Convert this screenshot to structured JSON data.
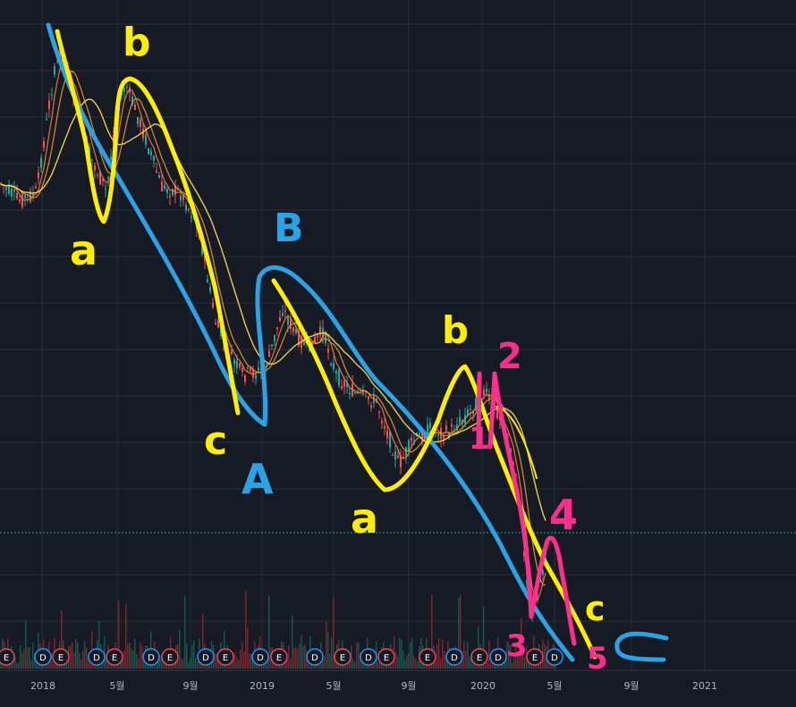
{
  "chart_data": {
    "type": "line",
    "title": "",
    "xlabel": "",
    "ylabel": "",
    "x_ticks": [
      "2018",
      "5월",
      "9월",
      "2019",
      "5월",
      "9월",
      "2020",
      "5월",
      "9월",
      "2021"
    ],
    "event_markers": [
      "E",
      "D",
      "E",
      "D",
      "E",
      "D",
      "E",
      "D",
      "E",
      "D",
      "E",
      "D",
      "E",
      "D",
      "E",
      "E",
      "D",
      "E",
      "D",
      "E",
      "D",
      "E",
      "D",
      "E"
    ],
    "annotations": [
      {
        "text": "b",
        "color": "#ffee00"
      },
      {
        "text": "a",
        "color": "#ffee00"
      },
      {
        "text": "B",
        "color": "#29a3e6"
      },
      {
        "text": "c",
        "color": "#ffee00"
      },
      {
        "text": "A",
        "color": "#29a3e6"
      },
      {
        "text": "b",
        "color": "#ffee00"
      },
      {
        "text": "a",
        "color": "#ffee00"
      },
      {
        "text": "2",
        "color": "#ff2d8b"
      },
      {
        "text": "1",
        "color": "#ff2d8b"
      },
      {
        "text": "4",
        "color": "#ff2d8b"
      },
      {
        "text": "3",
        "color": "#ff2d8b"
      },
      {
        "text": "c",
        "color": "#ffee00"
      },
      {
        "text": "5",
        "color": "#ff2d8b"
      },
      {
        "text": "C",
        "color": "#29a3e6"
      }
    ],
    "colors": {
      "background": "#161a25",
      "grid": "#2a2e39",
      "candle_up": "#26a69a",
      "candle_down": "#ef5350",
      "ma_fast": "#ff7b3a",
      "ma_slow": "#ffe14d",
      "drawing_yellow": "#ffee00",
      "drawing_blue": "#29a3e6",
      "drawing_pink": "#ff2d8b",
      "dotted_level": "#26a69a"
    },
    "grid": true
  }
}
